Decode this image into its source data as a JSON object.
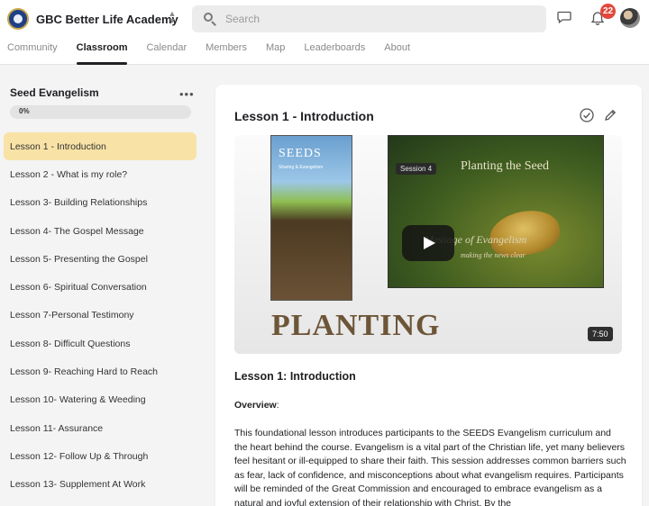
{
  "header": {
    "brand_name": "GBC Better Life Academy",
    "search_placeholder": "Search",
    "notification_count": "22",
    "icons": [
      "logo-icon",
      "switch-community-icon",
      "search-icon",
      "chat-icon",
      "bell-icon",
      "avatar"
    ]
  },
  "nav": {
    "tabs": [
      {
        "label": "Community"
      },
      {
        "label": "Classroom",
        "active": true
      },
      {
        "label": "Calendar"
      },
      {
        "label": "Members"
      },
      {
        "label": "Map"
      },
      {
        "label": "Leaderboards"
      },
      {
        "label": "About"
      }
    ]
  },
  "sidebar": {
    "course_title": "Seed Evangelism",
    "progress_label": "0%",
    "progress_value": 0,
    "lessons": [
      {
        "label": "Lesson 1 - Introduction",
        "active": true
      },
      {
        "label": "Lesson 2 - What is my role?"
      },
      {
        "label": "Lesson 3- Building Relationships"
      },
      {
        "label": "Lesson 4- The Gospel Message"
      },
      {
        "label": "Lesson 5- Presenting the Gospel"
      },
      {
        "label": "Lesson 6- Spiritual Conversation"
      },
      {
        "label": "Lesson 7-Personal Testimony"
      },
      {
        "label": "Lesson 8- Difficult Questions"
      },
      {
        "label": "Lesson 9- Reaching Hard to Reach"
      },
      {
        "label": "Lesson 10- Watering & Weeding"
      },
      {
        "label": "Lesson 11- Assurance"
      },
      {
        "label": "Lesson 12- Follow Up & Through"
      },
      {
        "label": "Lesson 13- Supplement At Work"
      }
    ]
  },
  "main": {
    "lesson_title": "Lesson 1 - Introduction",
    "video": {
      "dvd_title": "SEEDS",
      "dvd_subtitle": "Sharing & Evangelism",
      "session_label": "Session 4",
      "scene_title": "Planting the Seed",
      "scene_subtitle": "Message of Evangelism",
      "scene_tagline": "making the news clear",
      "banner_text": "PLANTING",
      "duration": "7:50"
    },
    "heading": "Lesson 1: Introduction",
    "overview_label": "Overview",
    "overview_suffix": ":",
    "body": "This foundational lesson introduces participants to the SEEDS Evangelism curriculum and the heart behind the course. Evangelism is a vital part of the Christian life, yet many believers feel hesitant or ill-equipped to share their faith. This session addresses common barriers such as fear, lack of confidence, and misconceptions about what evangelism requires. Participants will be reminded of the Great Commission and encouraged to embrace evangelism as a natural and joyful extension of their relationship with Christ. By the"
  },
  "colors": {
    "accent": "#f2cf6b",
    "active_lesson": "#f8e2a6",
    "badge": "#e2483d"
  }
}
